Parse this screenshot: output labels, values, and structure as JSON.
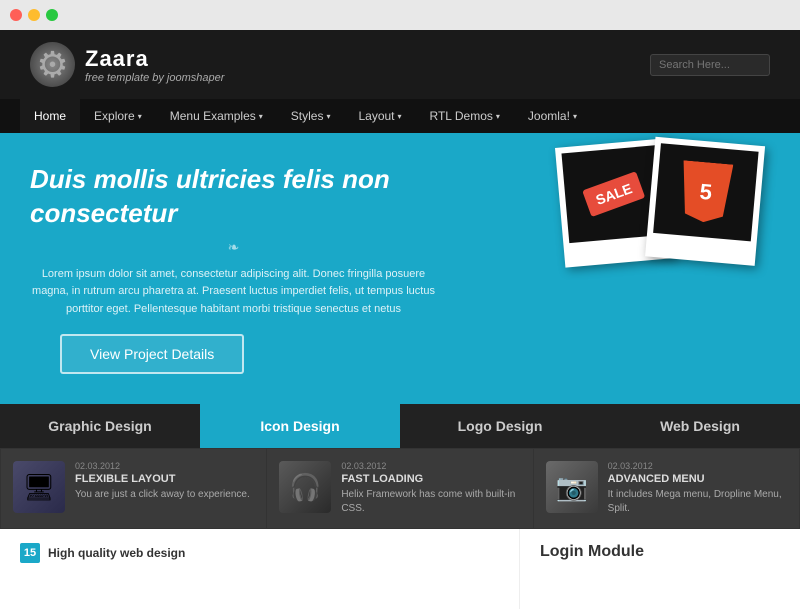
{
  "browser": {
    "dots": [
      "red",
      "yellow",
      "green"
    ]
  },
  "header": {
    "logo_title": "Zaara",
    "logo_subtitle": "free template by joomshaper",
    "search_placeholder": "Search Here..."
  },
  "nav": {
    "items": [
      {
        "label": "Home",
        "active": true,
        "has_arrow": false
      },
      {
        "label": "Explore",
        "active": false,
        "has_arrow": true
      },
      {
        "label": "Menu Examples",
        "active": false,
        "has_arrow": true
      },
      {
        "label": "Styles",
        "active": false,
        "has_arrow": true
      },
      {
        "label": "Layout",
        "active": false,
        "has_arrow": true
      },
      {
        "label": "RTL Demos",
        "active": false,
        "has_arrow": true
      },
      {
        "label": "Joomla!",
        "active": false,
        "has_arrow": true
      }
    ]
  },
  "hero": {
    "title": "Duis mollis ultricies felis non consectetur",
    "divider": "❧",
    "text": "Lorem ipsum dolor sit amet, consectetur adipiscing alit. Donec fringilla posuere magna, in rutrum arcu pharetra at. Praesent luctus imperdiet felis, ut tempus luctus porttitor eget. Pellentesque habitant morbi tristique senectus et netus",
    "button_label": "View Project Details",
    "sale_label": "SALE",
    "html5_label": "5"
  },
  "design_tabs": {
    "items": [
      {
        "label": "Graphic Design",
        "active": false
      },
      {
        "label": "Icon Design",
        "active": true
      },
      {
        "label": "Logo Design",
        "active": false
      },
      {
        "label": "Web Design",
        "active": false
      }
    ]
  },
  "feature_cards": [
    {
      "date": "02.03.2012",
      "title": "FLEXIBLE LAYOUT",
      "desc": "You are just a click away to experience.",
      "icon_type": "monitor"
    },
    {
      "date": "02.03.2012",
      "title": "FAST LOADING",
      "desc": "Helix Framework has come with built-in CSS.",
      "icon_type": "headphone"
    },
    {
      "date": "02.03.2012",
      "title": "ADVANCED MENU",
      "desc": "It includes Mega menu, Dropline Menu, Split.",
      "icon_type": "camera"
    }
  ],
  "bottom": {
    "left_number": "15",
    "left_title": "High quality web design",
    "right_title": "Login Module"
  }
}
